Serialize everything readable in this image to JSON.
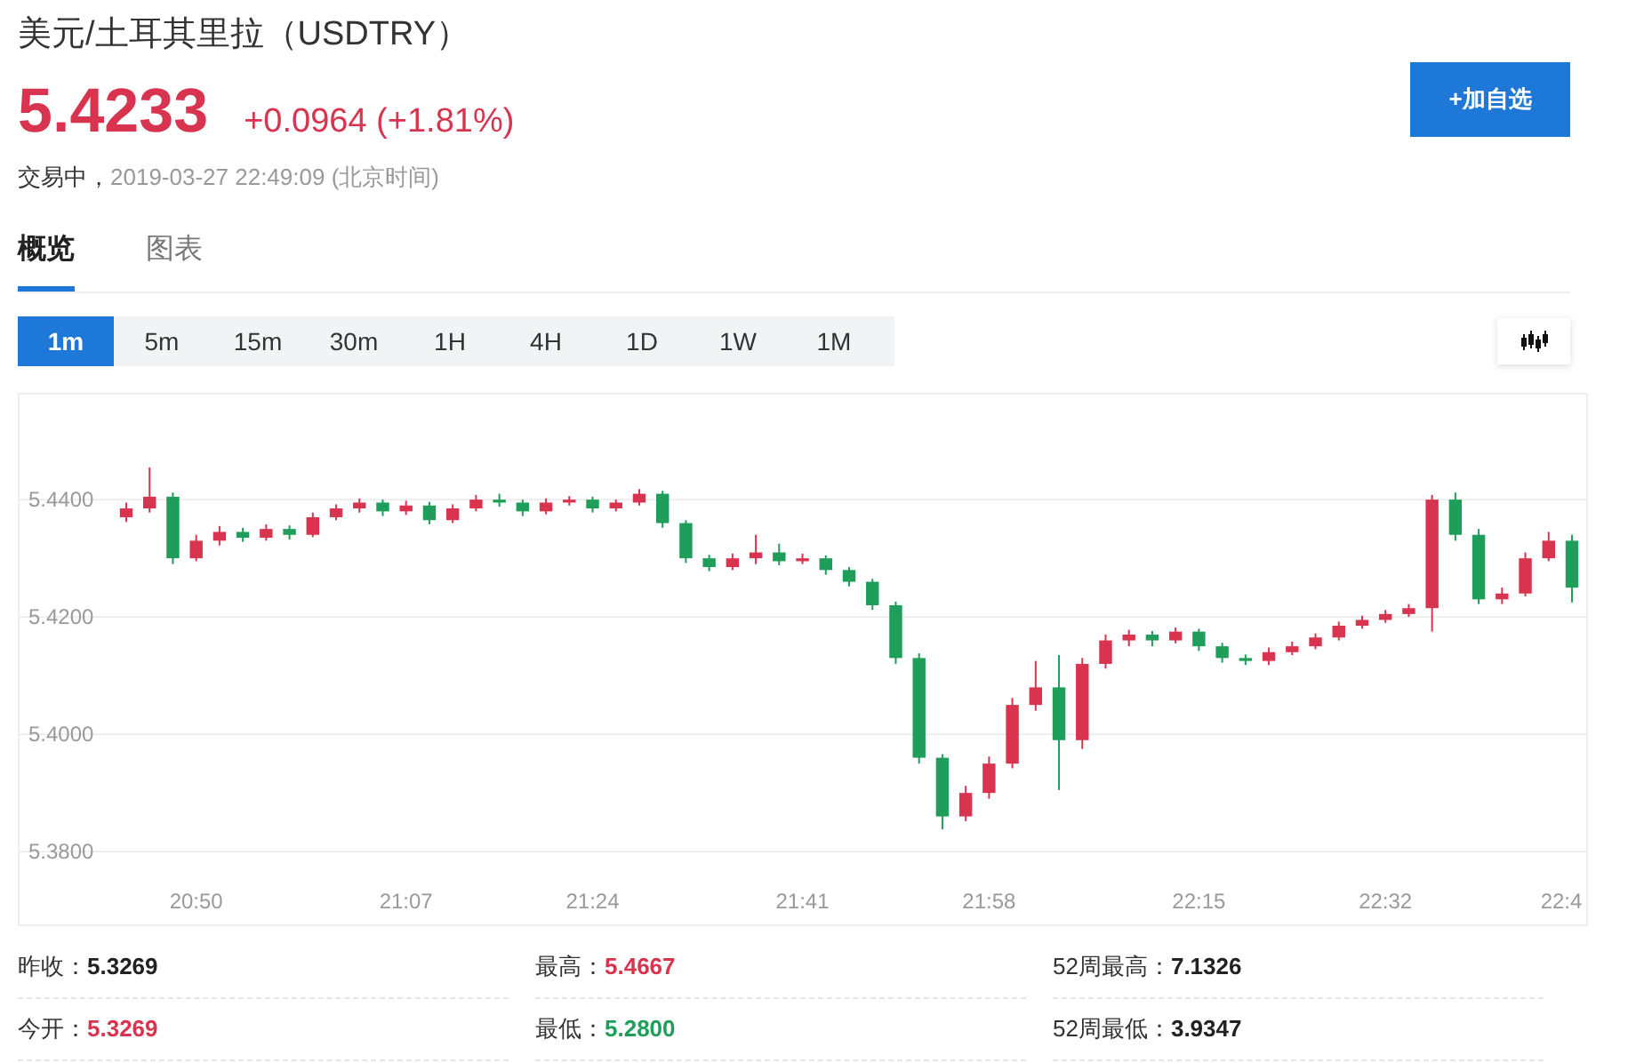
{
  "header": {
    "title": "美元/土耳其里拉（USDTRY）",
    "price": "5.4233",
    "change": "+0.0964 (+1.81%)",
    "status": "交易中，",
    "timestamp": "2019-03-27 22:49:09 (北京时间)",
    "watch_button": "+加自选"
  },
  "tabs": [
    {
      "label": "概览",
      "selected": true
    },
    {
      "label": "图表",
      "selected": false
    }
  ],
  "periods": [
    {
      "label": "1m",
      "selected": true
    },
    {
      "label": "5m",
      "selected": false
    },
    {
      "label": "15m",
      "selected": false
    },
    {
      "label": "30m",
      "selected": false
    },
    {
      "label": "1H",
      "selected": false
    },
    {
      "label": "4H",
      "selected": false
    },
    {
      "label": "1D",
      "selected": false
    },
    {
      "label": "1W",
      "selected": false
    },
    {
      "label": "1M",
      "selected": false
    }
  ],
  "chart": {
    "chart_data": {
      "type": "candlestick",
      "categories": [
        null,
        null,
        null,
        "20:50",
        null,
        null,
        null,
        null,
        null,
        null,
        null,
        null,
        "21:07",
        null,
        null,
        null,
        null,
        null,
        null,
        null,
        "21:24",
        null,
        null,
        null,
        null,
        null,
        null,
        null,
        null,
        "21:41",
        null,
        null,
        null,
        null,
        null,
        null,
        null,
        "21:58",
        null,
        null,
        null,
        null,
        null,
        null,
        null,
        null,
        "22:15",
        null,
        null,
        null,
        null,
        null,
        null,
        null,
        "22:32",
        null,
        null,
        null,
        null,
        null,
        null,
        null,
        "22:4"
      ],
      "ohlc": [
        [
          5.437,
          5.4395,
          5.4362,
          5.4385
        ],
        [
          5.4385,
          5.4455,
          5.4378,
          5.4405
        ],
        [
          5.4405,
          5.4412,
          5.429,
          5.43
        ],
        [
          5.43,
          5.434,
          5.4295,
          5.433
        ],
        [
          5.433,
          5.4355,
          5.4322,
          5.4345
        ],
        [
          5.4345,
          5.4352,
          5.4328,
          5.4335
        ],
        [
          5.4335,
          5.4358,
          5.433,
          5.435
        ],
        [
          5.435,
          5.4356,
          5.4332,
          5.434
        ],
        [
          5.434,
          5.4378,
          5.4336,
          5.437
        ],
        [
          5.437,
          5.4392,
          5.4365,
          5.4385
        ],
        [
          5.4385,
          5.4402,
          5.4378,
          5.4395
        ],
        [
          5.4395,
          5.44,
          5.4372,
          5.438
        ],
        [
          5.438,
          5.4398,
          5.4374,
          5.439
        ],
        [
          5.439,
          5.4396,
          5.4358,
          5.4365
        ],
        [
          5.4365,
          5.4392,
          5.436,
          5.4385
        ],
        [
          5.4385,
          5.4408,
          5.438,
          5.44
        ],
        [
          5.44,
          5.441,
          5.4388,
          5.4395
        ],
        [
          5.4395,
          5.44,
          5.4372,
          5.438
        ],
        [
          5.438,
          5.4402,
          5.4375,
          5.4395
        ],
        [
          5.4395,
          5.4406,
          5.439,
          5.44
        ],
        [
          5.44,
          5.4405,
          5.4378,
          5.4385
        ],
        [
          5.4385,
          5.44,
          5.438,
          5.4395
        ],
        [
          5.4395,
          5.4418,
          5.439,
          5.441
        ],
        [
          5.441,
          5.4415,
          5.4352,
          5.436
        ],
        [
          5.436,
          5.4365,
          5.4292,
          5.43
        ],
        [
          5.43,
          5.4306,
          5.4278,
          5.4285
        ],
        [
          5.4285,
          5.4308,
          5.428,
          5.43
        ],
        [
          5.43,
          5.434,
          5.429,
          5.431
        ],
        [
          5.431,
          5.4325,
          5.4288,
          5.4295
        ],
        [
          5.4295,
          5.4308,
          5.429,
          5.43
        ],
        [
          5.43,
          5.4305,
          5.4272,
          5.428
        ],
        [
          5.428,
          5.4285,
          5.4252,
          5.426
        ],
        [
          5.426,
          5.4265,
          5.4212,
          5.422
        ],
        [
          5.422,
          5.4226,
          5.412,
          5.413
        ],
        [
          5.413,
          5.4138,
          5.395,
          5.396
        ],
        [
          5.396,
          5.3966,
          5.3838,
          5.386
        ],
        [
          5.386,
          5.3912,
          5.3852,
          5.39
        ],
        [
          5.39,
          5.3962,
          5.389,
          5.395
        ],
        [
          5.395,
          5.4062,
          5.3942,
          5.405
        ],
        [
          5.405,
          5.4125,
          5.404,
          5.408
        ],
        [
          5.408,
          5.4135,
          5.3905,
          5.399
        ],
        [
          5.399,
          5.413,
          5.3975,
          5.412
        ],
        [
          5.412,
          5.417,
          5.4112,
          5.416
        ],
        [
          5.416,
          5.4178,
          5.415,
          5.417
        ],
        [
          5.417,
          5.4176,
          5.415,
          5.416
        ],
        [
          5.416,
          5.4182,
          5.4155,
          5.4175
        ],
        [
          5.4175,
          5.418,
          5.4142,
          5.415
        ],
        [
          5.415,
          5.4156,
          5.4122,
          5.413
        ],
        [
          5.413,
          5.4136,
          5.4118,
          5.4125
        ],
        [
          5.4125,
          5.4148,
          5.4118,
          5.414
        ],
        [
          5.414,
          5.4158,
          5.4135,
          5.415
        ],
        [
          5.415,
          5.4172,
          5.4145,
          5.4165
        ],
        [
          5.4165,
          5.4192,
          5.416,
          5.4185
        ],
        [
          5.4185,
          5.4202,
          5.418,
          5.4195
        ],
        [
          5.4195,
          5.4212,
          5.419,
          5.4205
        ],
        [
          5.4205,
          5.4222,
          5.42,
          5.4215
        ],
        [
          5.4215,
          5.4408,
          5.4175,
          5.44
        ],
        [
          5.44,
          5.4412,
          5.433,
          5.434
        ],
        [
          5.434,
          5.435,
          5.4222,
          5.423
        ],
        [
          5.423,
          5.425,
          5.4222,
          5.424
        ],
        [
          5.424,
          5.431,
          5.4235,
          5.43
        ],
        [
          5.43,
          5.4345,
          5.4295,
          5.433
        ],
        [
          5.433,
          5.434,
          5.4225,
          5.425
        ]
      ],
      "ylim": [
        5.3676,
        5.4579
      ],
      "grid": true,
      "yticks": [
        {
          "value": 5.44,
          "label": "5.4400"
        },
        {
          "value": 5.42,
          "label": "5.4200"
        },
        {
          "value": 5.4,
          "label": "5.4000"
        },
        {
          "value": 5.38,
          "label": "5.3800"
        }
      ]
    }
  },
  "stats": [
    {
      "label": "昨收：",
      "value": "5.3269",
      "color": "#222222"
    },
    {
      "label": "最高：",
      "value": "5.4667",
      "color": "#d8344f"
    },
    {
      "label": "52周最高：",
      "value": "7.1326",
      "color": "#222222"
    },
    {
      "label": "今开：",
      "value": "5.3269",
      "color": "#d8344f"
    },
    {
      "label": "最低：",
      "value": "5.2800",
      "color": "#1f9d5a"
    },
    {
      "label": "52周最低：",
      "value": "3.9347",
      "color": "#222222"
    }
  ]
}
